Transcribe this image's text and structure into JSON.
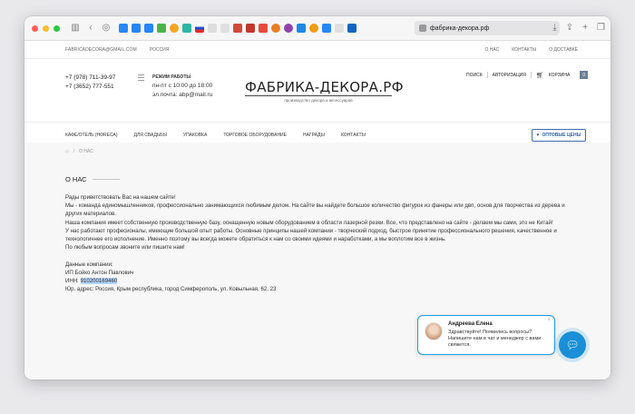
{
  "browser": {
    "url": "фабрика-декора.рф",
    "colors": {
      "close": "#ff5f57",
      "minimize": "#febc2e",
      "maximize": "#28c840"
    },
    "icons": [
      "sidebar-icon",
      "back-icon",
      "shield-icon",
      "share-icon",
      "new-tab-icon",
      "tabs-icon"
    ]
  },
  "topbar": {
    "email": "FABRICADECORA@GMAIL.COM",
    "region": "РОССИЯ",
    "links": [
      "О НАС",
      "КОНТАКТЫ",
      "О ДОСТАВКЕ"
    ]
  },
  "header": {
    "phone1": "+7 (978) 711-39-97",
    "phone2": "+7 (3652) 777-551",
    "hours_title": "РЕЖИМ РАБОТЫ",
    "hours_line": "пн-пт с 10:00 до 18:00",
    "hours_email": "эл.почта: abp@mail.ru",
    "logo_title": "ФАБРИКА-ДЕКОРА.РФ",
    "logo_subtitle": "производство декора и аксессуаров",
    "search": "ПОИСК",
    "auth": "АВТОРИЗАЦИЯ",
    "cart": "КОРЗИНА",
    "cart_count": "0"
  },
  "nav": {
    "items": [
      "КАФЕ/ОТЕЛЬ (HORECA)",
      "ДЛЯ СВАДЬБЫ",
      "УПАКОВКА",
      "ТОРГОВОЕ ОБОРУДОВАНИЕ",
      "НАГРАДЫ",
      "КОНТАКТЫ"
    ],
    "price_button": "ОПТОВЫЕ ЦЕНЫ",
    "accent": "#2f5f9e"
  },
  "page": {
    "breadcrumb_current": "О НАС",
    "title": "О НАС",
    "p1": "Рады приветствовать Вас на нашем сайте!",
    "p2": "Мы - команда единомышленников, профессионально занимающихся любимым делом. На сайте вы найдете большое количество  фигурок из фанеры  или двп, основ  для творчества из дерева и других материалов.",
    "p3": "Наша компания имеет собственную производственную базу, оснащенную новым оборудованием в области лазерной резки. Все, что представлено на сайте - делаем мы сами, это не Китай!",
    "p4": "У нас работают професионалы, имеющие большой опыт работы. Основные принципы нашей компании - творческий подход, быстрое принятие профессионального решения, качественное и технологичнее его исполнение.  Именно поэтому  вы всегда можете обратиться к нам  со своими идеями и наработками, а мы воплотим все в жизнь.",
    "p5": "По любым вопросам звоните или пишите нам!",
    "company_label": "Данные компании:",
    "company_name": "ИП Бойко Антон Павлович",
    "inn_label": "ИНН: ",
    "inn_value": "910200169460",
    "address": "Юр. адрес: Россия, Крым республика, город Симферополь, ул. Ковыльная, 62, 23"
  },
  "chat": {
    "name": "Андреева Елена",
    "message": "Здравствуйте! Появились вопросы? Напишите нам в чат и менеджер с вами свяжется.",
    "accent": "#1a9be6"
  }
}
